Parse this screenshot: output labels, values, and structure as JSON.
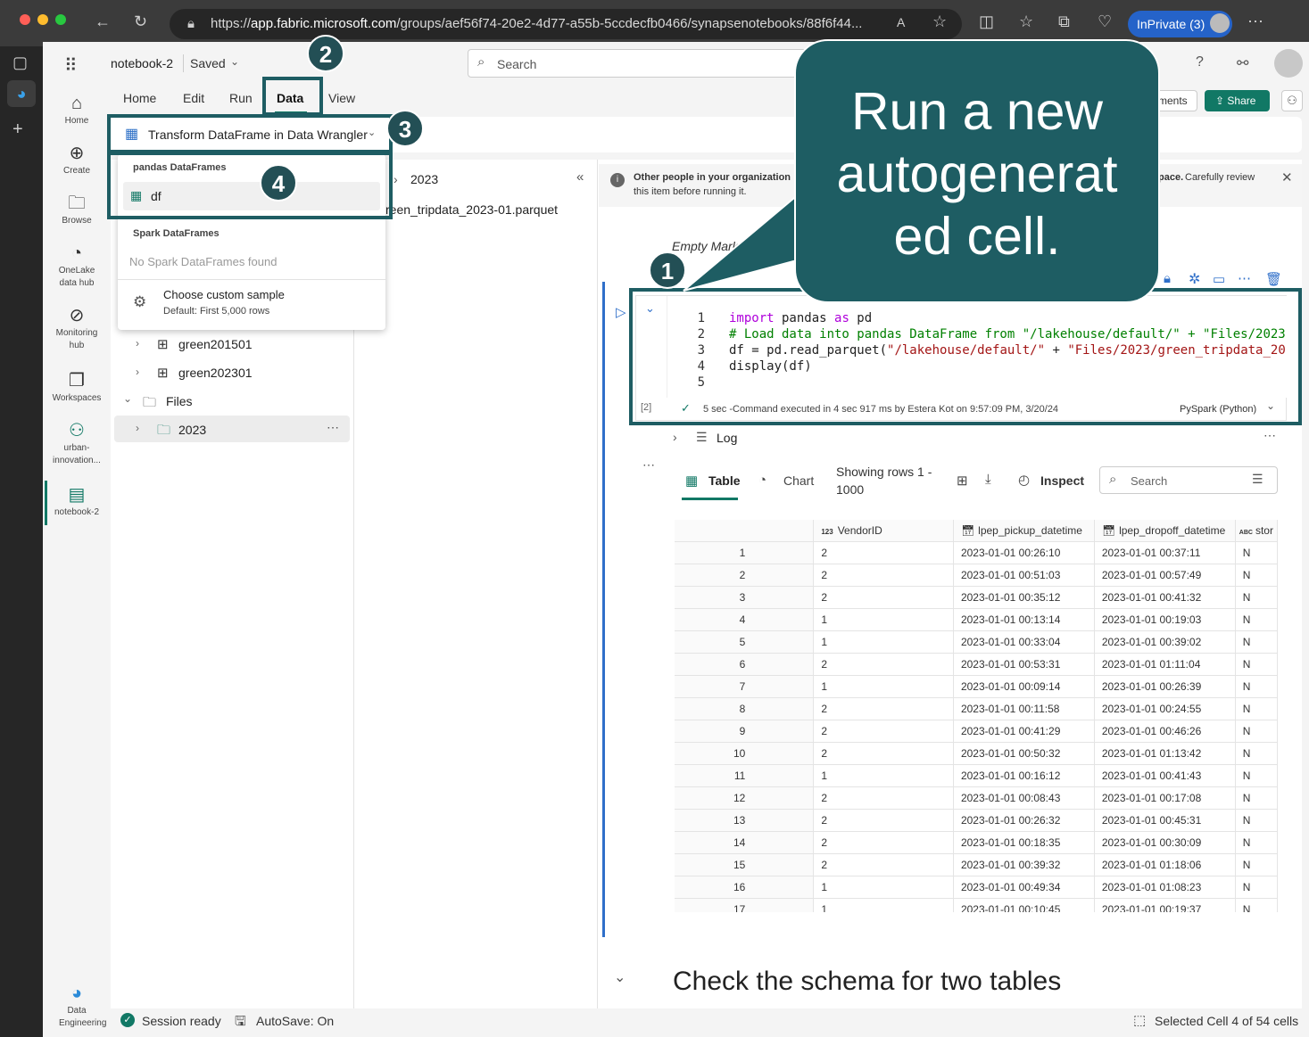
{
  "browser": {
    "url_prefix": "https://",
    "url_host": "app.fabric.microsoft.com",
    "url_path": "/groups/aef56f74-20e2-4d77-a55b-5ccdecfb0466/synapsenotebooks/88f6f44...",
    "inprivate_label": "InPrivate (3)"
  },
  "rail": {
    "items": [
      {
        "label": "Home",
        "icon": "home-icon"
      },
      {
        "label": "Create",
        "icon": "create-icon"
      },
      {
        "label": "Browse",
        "icon": "browse-icon"
      },
      {
        "label": "OneLake data hub",
        "icon": "onelake-icon"
      },
      {
        "label": "Monitoring hub",
        "icon": "monitoring-icon"
      },
      {
        "label": "Workspaces",
        "icon": "workspaces-icon"
      },
      {
        "label": "urban-innovation...",
        "icon": "workspace-icon"
      },
      {
        "label": "notebook-2",
        "icon": "notebook-icon"
      }
    ],
    "bottom_label": "Data Engineering"
  },
  "header": {
    "notebook_name": "notebook-2",
    "saved": "Saved",
    "search_placeholder": "Search",
    "comments": "ments",
    "share": "Share"
  },
  "ribbon": {
    "tabs": [
      "Home",
      "Edit",
      "Run",
      "Data",
      "View"
    ],
    "active_tab": "Data",
    "transform_button": "Transform DataFrame in Data Wrangler"
  },
  "dropdown": {
    "pandas_header": "pandas DataFrames",
    "pandas_item": "df",
    "spark_header": "Spark DataFrames",
    "spark_empty": "No Spark DataFrames found",
    "custom_title": "Choose custom sample",
    "custom_sub": "Default: First 5,000 rows"
  },
  "explorer": {
    "items": [
      "green201501",
      "green202301",
      "Files",
      "2023"
    ],
    "folder_title": "2023",
    "file": "reen_tripdata_2023-01.parquet"
  },
  "banner": {
    "bold": "Other people in your organization",
    "bold_tail": "pace.",
    "rest": "Carefully review",
    "line2": "this item before running it."
  },
  "cells": {
    "markdown_placeholder": "Empty Markdo",
    "exec_count": "[2]",
    "status": "5 sec -Command executed in 4 sec 917 ms by Estera Kot on 9:57:09 PM, 3/20/24",
    "language": "PySpark (Python)",
    "log_label": "Log",
    "code": {
      "l1": {
        "kw1": "import",
        "mid": " pandas ",
        "kw2": "as",
        "end": " pd"
      },
      "l2": "# Load data into pandas DataFrame from \"/lakehouse/default/\" + \"Files/2023",
      "l3a": "df = pd.read_parquet(",
      "l3s1": "\"/lakehouse/default/\"",
      "l3b": " + ",
      "l3s2": "\"Files/2023/green_tripdata_20",
      "l4": "display(df)",
      "line_numbers": [
        "1",
        "2",
        "3",
        "4",
        "5"
      ]
    }
  },
  "output": {
    "tab_table": "Table",
    "tab_chart": "Chart",
    "rows_info_1": "Showing rows 1 -",
    "rows_info_2": "1000",
    "inspect": "Inspect",
    "search_placeholder": "Search",
    "columns": [
      {
        "type": "",
        "name": ""
      },
      {
        "type": "123",
        "name": "VendorID"
      },
      {
        "type": "cal",
        "name": "lpep_pickup_datetime"
      },
      {
        "type": "cal",
        "name": "lpep_dropoff_datetime"
      },
      {
        "type": "ABC",
        "name": "stor"
      }
    ],
    "rows": [
      [
        "1",
        "2",
        "2023-01-01 00:26:10",
        "2023-01-01 00:37:11",
        "N"
      ],
      [
        "2",
        "2",
        "2023-01-01 00:51:03",
        "2023-01-01 00:57:49",
        "N"
      ],
      [
        "3",
        "2",
        "2023-01-01 00:35:12",
        "2023-01-01 00:41:32",
        "N"
      ],
      [
        "4",
        "1",
        "2023-01-01 00:13:14",
        "2023-01-01 00:19:03",
        "N"
      ],
      [
        "5",
        "1",
        "2023-01-01 00:33:04",
        "2023-01-01 00:39:02",
        "N"
      ],
      [
        "6",
        "2",
        "2023-01-01 00:53:31",
        "2023-01-01 01:11:04",
        "N"
      ],
      [
        "7",
        "1",
        "2023-01-01 00:09:14",
        "2023-01-01 00:26:39",
        "N"
      ],
      [
        "8",
        "2",
        "2023-01-01 00:11:58",
        "2023-01-01 00:24:55",
        "N"
      ],
      [
        "9",
        "2",
        "2023-01-01 00:41:29",
        "2023-01-01 00:46:26",
        "N"
      ],
      [
        "10",
        "2",
        "2023-01-01 00:50:32",
        "2023-01-01 01:13:42",
        "N"
      ],
      [
        "11",
        "1",
        "2023-01-01 00:16:12",
        "2023-01-01 00:41:43",
        "N"
      ],
      [
        "12",
        "2",
        "2023-01-01 00:08:43",
        "2023-01-01 00:17:08",
        "N"
      ],
      [
        "13",
        "2",
        "2023-01-01 00:26:32",
        "2023-01-01 00:45:31",
        "N"
      ],
      [
        "14",
        "2",
        "2023-01-01 00:18:35",
        "2023-01-01 00:30:09",
        "N"
      ],
      [
        "15",
        "2",
        "2023-01-01 00:39:32",
        "2023-01-01 01:18:06",
        "N"
      ],
      [
        "16",
        "1",
        "2023-01-01 00:49:34",
        "2023-01-01 01:08:23",
        "N"
      ],
      [
        "17",
        "1",
        "2023-01-01 00:10:45",
        "2023-01-01 00:19:37",
        "N"
      ]
    ]
  },
  "next_heading": "Check the schema for two tables",
  "status": {
    "session": "Session ready",
    "autosave": "AutoSave: On",
    "selected": "Selected Cell 4 of 54 cells"
  },
  "callout": {
    "text": "Run a new autogenerat ed cell.",
    "line1": "Run a new",
    "line2": "autogenerat",
    "line3": "ed cell.",
    "badges": [
      "1",
      "2",
      "3",
      "4"
    ]
  },
  "colors": {
    "callout": "#1e5d63",
    "accent": "#117865",
    "brand_blue": "#2563c9"
  }
}
